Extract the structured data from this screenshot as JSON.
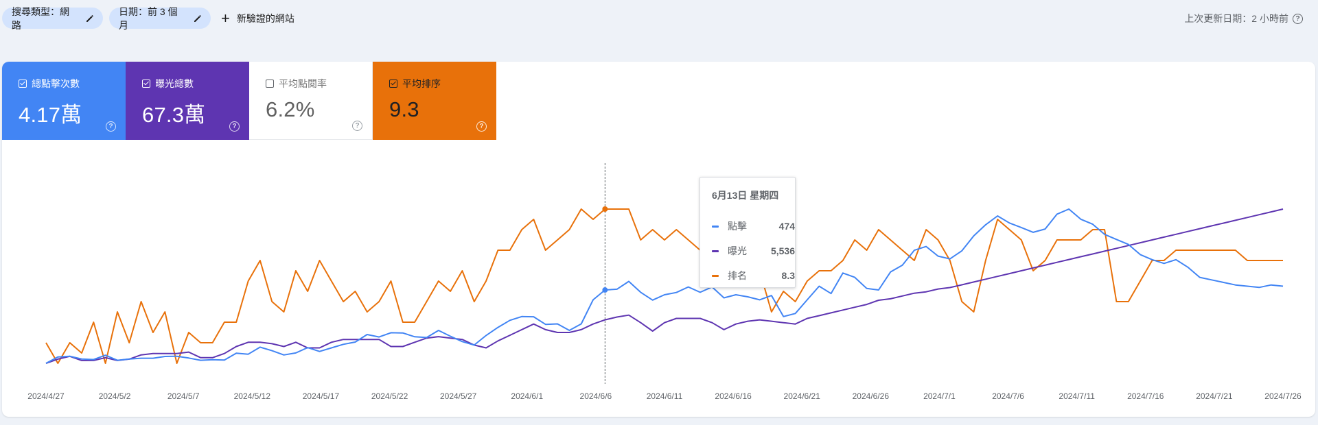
{
  "filters": {
    "search_type": "搜尋類型：網路",
    "date": "日期：前 3 個月",
    "add_comparison": "新驗證的網站"
  },
  "last_updated": "上次更新日期：2 小時前",
  "metrics": [
    {
      "label": "總點擊次數",
      "value": "4.17萬",
      "checked": true,
      "color": "#4285f4"
    },
    {
      "label": "曝光總數",
      "value": "67.3萬",
      "checked": true,
      "color": "#5e35b1"
    },
    {
      "label": "平均點閱率",
      "value": "6.2%",
      "checked": false,
      "color": "#ffffff"
    },
    {
      "label": "平均排序",
      "value": "9.3",
      "checked": true,
      "color": "#e8710a"
    }
  ],
  "tooltip": {
    "date": "6月13日 星期四",
    "rows": [
      {
        "name": "點擊",
        "value": "474",
        "color": "#4285f4"
      },
      {
        "name": "曝光",
        "value": "5,536",
        "color": "#5e35b1"
      },
      {
        "name": "排名",
        "value": "8.3",
        "color": "#e8710a"
      }
    ]
  },
  "chart_data": {
    "type": "line",
    "x_ticks": [
      "2024/4/27",
      "2024/5/2",
      "2024/5/7",
      "2024/5/12",
      "2024/5/17",
      "2024/5/22",
      "2024/5/27",
      "2024/6/1",
      "2024/6/6",
      "2024/6/11",
      "2024/6/16",
      "2024/6/21",
      "2024/6/26",
      "2024/7/1",
      "2024/7/6",
      "2024/7/11",
      "2024/7/16",
      "2024/7/21",
      "2024/7/26"
    ],
    "start_date": "2024-04-27",
    "hover_index": 47,
    "series": [
      {
        "name": "點擊",
        "color": "#4285f4",
        "values": [
          150,
          175,
          178,
          167,
          165,
          182,
          162,
          167,
          170,
          170,
          177,
          178,
          171,
          162,
          164,
          163,
          190,
          186,
          214,
          200,
          183,
          191,
          212,
          197,
          211,
          225,
          234,
          264,
          254,
          271,
          270,
          255,
          252,
          280,
          257,
          236,
          222,
          260,
          292,
          320,
          335,
          334,
          304,
          306,
          280,
          306,
          401,
          440,
          443,
          474,
          431,
          400,
          421,
          430,
          452,
          431,
          452,
          409,
          421,
          413,
          401,
          418,
          335,
          347,
          401,
          455,
          426,
          507,
          490,
          446,
          440,
          511,
          538,
          597,
          612,
          574,
          563,
          595,
          654,
          698,
          733,
          705,
          687,
          668,
          681,
          740,
          760,
          720,
          700,
          660,
          640,
          620,
          580,
          560,
          545,
          560,
          530,
          490,
          480,
          470,
          460,
          455,
          450,
          460,
          455
        ],
        "note": "approximate daily clicks"
      },
      {
        "name": "曝光",
        "color": "#5e35b1",
        "values": [
          2100,
          2400,
          2600,
          2300,
          2300,
          2500,
          2300,
          2400,
          2700,
          2800,
          2800,
          2800,
          2900,
          2500,
          2500,
          2800,
          3300,
          3600,
          3600,
          3500,
          3300,
          3600,
          3200,
          3200,
          3600,
          3800,
          3800,
          3800,
          3800,
          3300,
          3300,
          3600,
          3900,
          4000,
          3900,
          3800,
          3400,
          3200,
          3700,
          4100,
          4500,
          4900,
          4500,
          4300,
          4300,
          4500,
          4900,
          5200,
          5400,
          5536,
          5000,
          4400,
          5000,
          5300,
          5300,
          5300,
          5000,
          4500,
          4900,
          5100,
          5200,
          5100,
          5000,
          4900,
          5300,
          5500,
          5700,
          5900,
          6100,
          6300,
          6600,
          6700,
          6900,
          7100,
          7200,
          7400,
          7500,
          7700,
          7900,
          8100,
          8300,
          8500,
          8700,
          8900,
          9100,
          9300,
          9500,
          9700,
          9900,
          10100,
          10300,
          10500,
          10700,
          10900,
          11100,
          11300,
          11500,
          11700,
          11900,
          12100,
          12300,
          12500,
          12700,
          12900,
          13100
        ],
        "note": "approximate daily impressions"
      },
      {
        "name": "排名",
        "color": "#e8710a",
        "values": [
          9.6,
          9.8,
          9.6,
          9.7,
          9.4,
          9.8,
          9.3,
          9.6,
          9.2,
          9.5,
          9.3,
          9.8,
          9.5,
          9.6,
          9.6,
          9.4,
          9.4,
          9.0,
          8.8,
          9.2,
          9.3,
          8.9,
          9.1,
          8.8,
          9.0,
          9.2,
          9.1,
          9.3,
          9.2,
          9.0,
          9.4,
          9.4,
          9.2,
          9.0,
          9.1,
          8.9,
          9.2,
          9.0,
          8.7,
          8.7,
          8.5,
          8.4,
          8.7,
          8.6,
          8.5,
          8.3,
          8.4,
          8.3,
          8.3,
          8.3,
          8.6,
          8.5,
          8.6,
          8.5,
          8.6,
          8.7,
          8.7,
          8.9,
          8.6,
          8.8,
          8.9,
          9.3,
          9.1,
          9.2,
          9.0,
          8.9,
          8.9,
          8.8,
          8.6,
          8.7,
          8.5,
          8.6,
          8.7,
          8.8,
          8.5,
          8.6,
          8.8,
          9.2,
          9.3,
          8.8,
          8.4,
          8.5,
          8.6,
          8.9,
          8.8,
          8.6,
          8.6,
          8.6,
          8.5,
          8.5,
          9.2,
          9.2,
          9.0,
          8.8,
          8.8,
          8.7,
          8.7,
          8.7,
          8.7,
          8.7,
          8.7,
          8.8,
          8.8,
          8.8,
          8.8
        ],
        "note": "approximate daily average position"
      }
    ]
  }
}
